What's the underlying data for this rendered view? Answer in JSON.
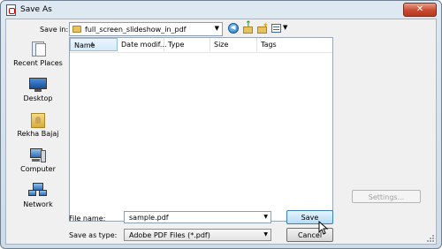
{
  "window": {
    "title": "Save As"
  },
  "toolbar": {
    "save_in_label": "Save in:",
    "current_folder": "full_screen_slideshow_in_pdf"
  },
  "places": [
    {
      "label": "Recent Places",
      "icon": "recent-places-icon"
    },
    {
      "label": "Desktop",
      "icon": "desktop-icon"
    },
    {
      "label": "Rekha Bajaj",
      "icon": "user-folder-icon"
    },
    {
      "label": "Computer",
      "icon": "computer-icon"
    },
    {
      "label": "Network",
      "icon": "network-icon"
    }
  ],
  "file_list": {
    "columns": [
      "Name",
      "Date modif...",
      "Type",
      "Size",
      "Tags"
    ],
    "sorted_by": "Name"
  },
  "buttons": {
    "settings": "Settings...",
    "save": "Save",
    "cancel": "Cancel"
  },
  "form": {
    "file_name_label": "File name:",
    "file_name_value": "sample.pdf",
    "save_as_type_label": "Save as type:",
    "save_as_type_value": "Adobe PDF Files (*.pdf)"
  }
}
